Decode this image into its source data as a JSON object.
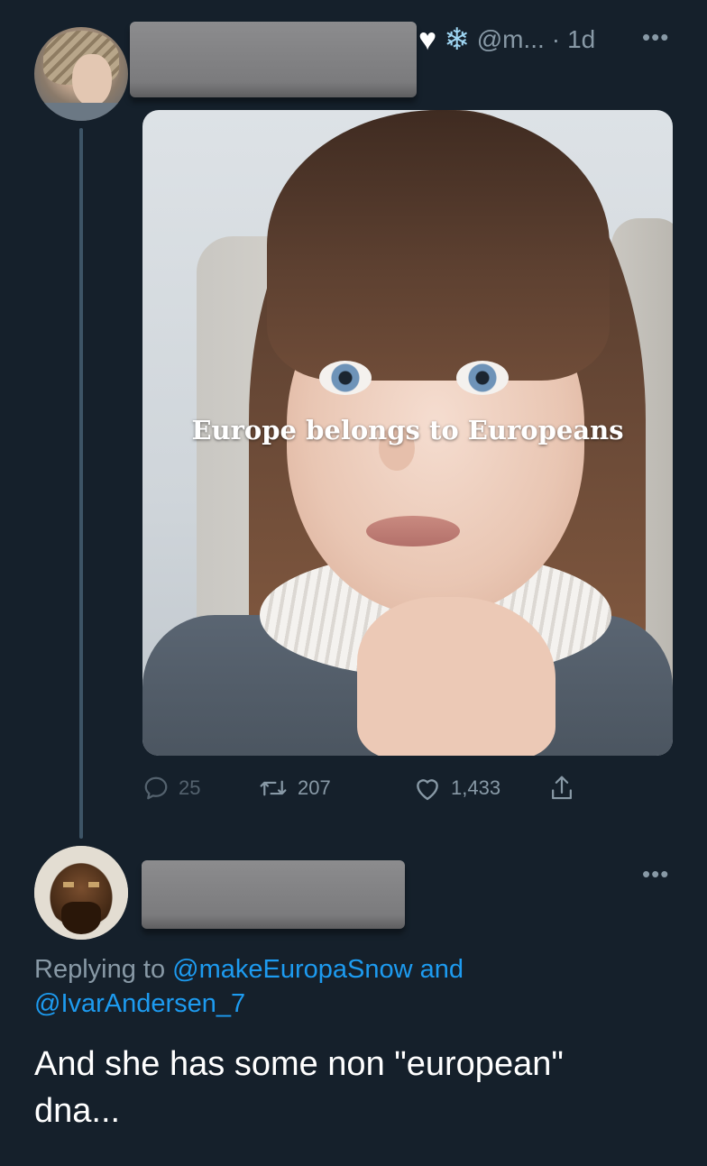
{
  "tweet1": {
    "handle": "@m...",
    "separator": "·",
    "time": "1d",
    "more": "•••",
    "media_caption": "Europe belongs to Europeans",
    "stats": {
      "replies": "25",
      "retweets": "207",
      "likes": "1,433"
    }
  },
  "tweet2": {
    "more": "•••",
    "replying_prefix": "Replying to",
    "mention_1": "@makeEuropaSnow",
    "conjunction": "and",
    "mention_2": "@IvarAndersen_7",
    "text_line_1": "And she has some non \"european\"",
    "text_line_2": "dna..."
  },
  "colors": {
    "background": "#15202b",
    "secondary_text": "#8899a6",
    "link": "#1d9bf0",
    "redaction": "#7b7b7d"
  },
  "icons": [
    "white-heart-emoji-icon",
    "snowflake-emoji-icon",
    "reply-icon",
    "retweet-icon",
    "like-icon",
    "share-icon",
    "more-icon"
  ]
}
